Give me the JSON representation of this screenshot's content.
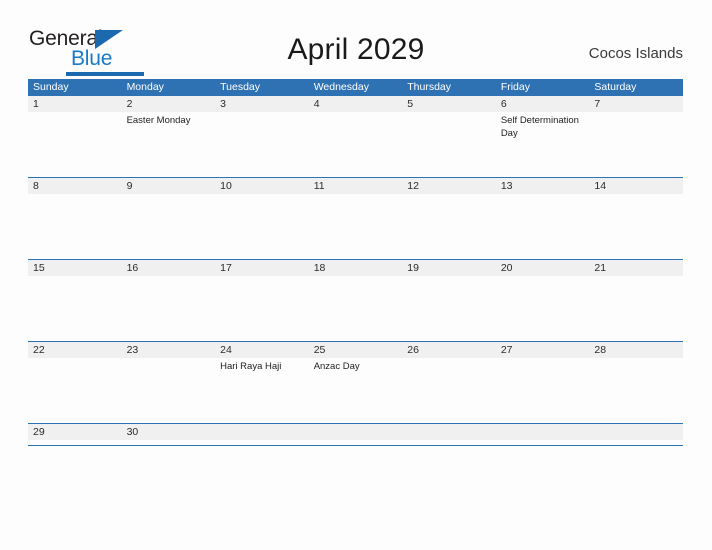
{
  "brand": {
    "name_top": "General",
    "name_bottom": "Blue",
    "accent_color": "#1b6ab0",
    "accent_color_light": "#1b7ac4"
  },
  "header": {
    "title": "April 2029",
    "location": "Cocos Islands"
  },
  "calendar": {
    "header_color": "#2f72b3",
    "band_color": "#f0f0f0",
    "weekdays": [
      "Sunday",
      "Monday",
      "Tuesday",
      "Wednesday",
      "Thursday",
      "Friday",
      "Saturday"
    ],
    "weeks": [
      {
        "height": "tall",
        "days": [
          {
            "date": "1",
            "event": ""
          },
          {
            "date": "2",
            "event": "Easter Monday"
          },
          {
            "date": "3",
            "event": ""
          },
          {
            "date": "4",
            "event": ""
          },
          {
            "date": "5",
            "event": ""
          },
          {
            "date": "6",
            "event": "Self Determination Day"
          },
          {
            "date": "7",
            "event": ""
          }
        ]
      },
      {
        "height": "tall",
        "days": [
          {
            "date": "8",
            "event": ""
          },
          {
            "date": "9",
            "event": ""
          },
          {
            "date": "10",
            "event": ""
          },
          {
            "date": "11",
            "event": ""
          },
          {
            "date": "12",
            "event": ""
          },
          {
            "date": "13",
            "event": ""
          },
          {
            "date": "14",
            "event": ""
          }
        ]
      },
      {
        "height": "tall",
        "days": [
          {
            "date": "15",
            "event": ""
          },
          {
            "date": "16",
            "event": ""
          },
          {
            "date": "17",
            "event": ""
          },
          {
            "date": "18",
            "event": ""
          },
          {
            "date": "19",
            "event": ""
          },
          {
            "date": "20",
            "event": ""
          },
          {
            "date": "21",
            "event": ""
          }
        ]
      },
      {
        "height": "tall",
        "days": [
          {
            "date": "22",
            "event": ""
          },
          {
            "date": "23",
            "event": ""
          },
          {
            "date": "24",
            "event": "Hari Raya Haji"
          },
          {
            "date": "25",
            "event": "Anzac Day"
          },
          {
            "date": "26",
            "event": ""
          },
          {
            "date": "27",
            "event": ""
          },
          {
            "date": "28",
            "event": ""
          }
        ]
      },
      {
        "height": "short",
        "days": [
          {
            "date": "29",
            "event": ""
          },
          {
            "date": "30",
            "event": ""
          },
          {
            "date": "",
            "event": ""
          },
          {
            "date": "",
            "event": ""
          },
          {
            "date": "",
            "event": ""
          },
          {
            "date": "",
            "event": ""
          },
          {
            "date": "",
            "event": ""
          }
        ]
      }
    ]
  }
}
